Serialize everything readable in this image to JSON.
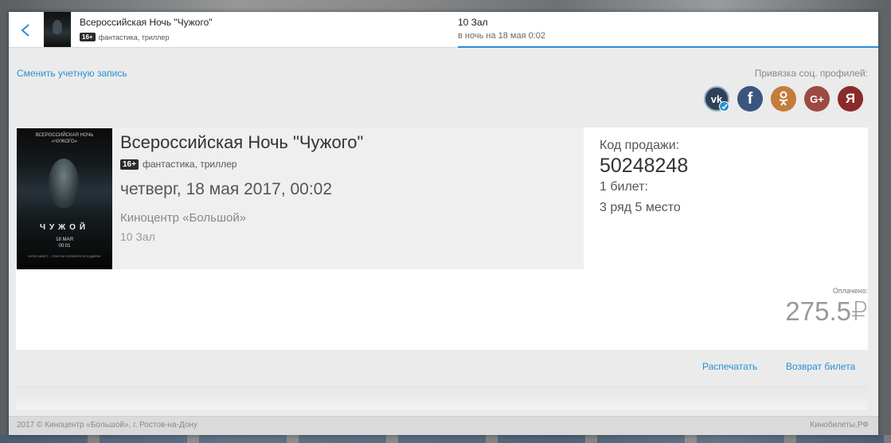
{
  "header": {
    "movie_title": "Всероссийская Ночь \"Чужого\"",
    "age": "16+",
    "genre": "фантастика, триллер",
    "hall": "10 Зал",
    "time": "в ночь на 18 мая 0:02"
  },
  "account": {
    "change_label": "Сменить учетную запись",
    "social_caption": "Привязка соц. профилей:"
  },
  "social": [
    {
      "name": "vk",
      "glyph": "vk",
      "color": "#2d4257"
    },
    {
      "name": "facebook",
      "glyph": "f",
      "color": "#3a557f"
    },
    {
      "name": "odnoklassniki",
      "glyph": "ok",
      "color": "#c27d3a"
    },
    {
      "name": "google-plus",
      "glyph": "G+",
      "color": "#9c4a43"
    },
    {
      "name": "yandex",
      "glyph": "Я",
      "color": "#8a2a2a"
    }
  ],
  "poster": {
    "top_text": "ВСЕРОССИЙСКАЯ НОЧЬ\n«ЧУЖОГО»",
    "title": "ЧУЖОЙ",
    "date": "18 МАЯ\n00:01",
    "foot": "КУПИ БИЛЕТ – ПОЛУЧИ ПОПКОРН В ПОДАРОК"
  },
  "ticket": {
    "title": "Всероссийская Ночь \"Чужого\"",
    "age": "16+",
    "genre": "фантастика, триллер",
    "datetime": "четверг, 18 мая 2017, 00:02",
    "cinema": "Киноцентр «Большой»",
    "hall": "10 Зал",
    "code_label": "Код продажи:",
    "code": "50248248",
    "count": "1 билет:",
    "seat": "3 ряд 5 место",
    "paid_label": "Оплачено:",
    "paid_amount": "275.5₽"
  },
  "actions": {
    "print": "Распечатать",
    "return": "Возврат билета"
  },
  "footer": {
    "left": "2017 © Киноцентр «Большой», г. Ростов-на-Дону",
    "right": "Кинобилеты.РФ"
  },
  "colors": {
    "accent": "#2a8fd6",
    "card_bg": "#efefef",
    "modal_bg": "#ebebeb"
  }
}
